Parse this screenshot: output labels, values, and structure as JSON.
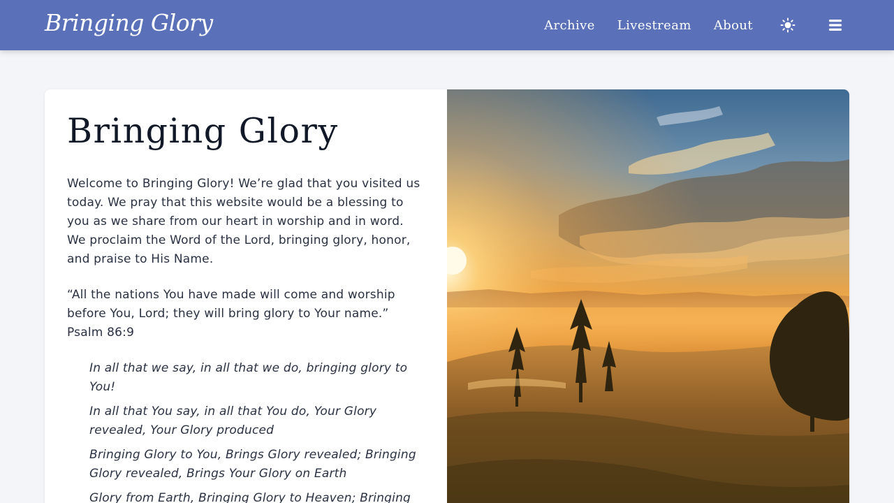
{
  "nav": {
    "brand": "Bringing Glory",
    "links": [
      {
        "label": "Archive"
      },
      {
        "label": "Livestream"
      },
      {
        "label": "About"
      }
    ],
    "theme_icon": "sun-icon",
    "menu_icon": "hamburger-menu-icon"
  },
  "main": {
    "title": "Bringing Glory",
    "intro": "Welcome to Bringing Glory! We’re glad that you visited us today. We pray that this website would be a blessing to you as we share from our heart in worship and in word. We proclaim the Word of the Lord, bringing glory, honor, and praise to His Name.",
    "quote": "“All the nations You have made will come and worship before You, Lord; they will bring glory to Your name.”",
    "quote_reference": "Psalm 86:9",
    "lyrics": [
      "In all that we say, in all that we do, bringing glory to You!",
      "In all that You say, in all that You do, Your Glory revealed, Your Glory produced",
      "Bringing Glory to You, Brings Glory revealed; Bringing Glory revealed, Brings Your Glory on Earth",
      "Glory from Earth, Bringing Glory to Heaven; Bringing"
    ],
    "image": "sunrise-meadow-landscape"
  },
  "colors": {
    "navbar": "#5a71b9",
    "page_background": "#f3f5f8",
    "card_background": "#ffffff",
    "heading_text": "#111827",
    "body_text": "#2a3142"
  }
}
